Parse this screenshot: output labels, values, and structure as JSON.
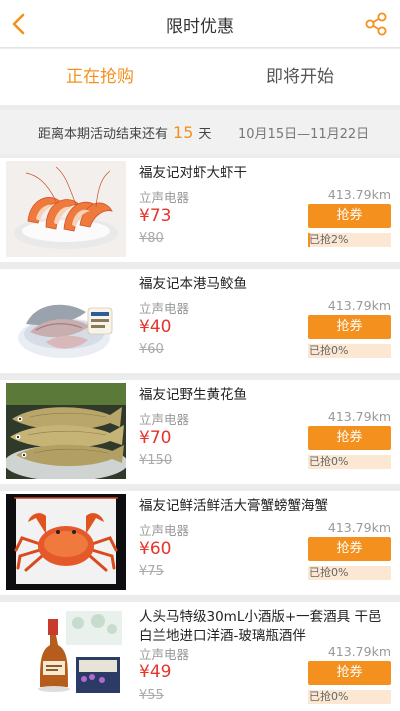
{
  "header": {
    "title": "限时优惠"
  },
  "tabs": [
    {
      "label": "正在抢购",
      "active": true
    },
    {
      "label": "即将开始",
      "active": false
    }
  ],
  "countdown": {
    "prefix": "距离本期活动结束还有",
    "days": "15",
    "suffix": "天",
    "range": "10月15日—11月22日"
  },
  "products": [
    {
      "name": "福友记对虾大虾干",
      "store": "立声电器",
      "distance": "413.79km",
      "price": "¥73",
      "original_price": "¥80",
      "button": "抢券",
      "progress_label": "已抢2%",
      "progress": 0.02,
      "image": "shrimp"
    },
    {
      "name": "福友记本港马鲛鱼",
      "store": "立声电器",
      "distance": "413.79km",
      "price": "¥40",
      "original_price": "¥60",
      "button": "抢券",
      "progress_label": "已抢0%",
      "progress": 0,
      "image": "mackerel"
    },
    {
      "name": "福友记野生黄花鱼",
      "store": "立声电器",
      "distance": "413.79km",
      "price": "¥70",
      "original_price": "¥150",
      "button": "抢券",
      "progress_label": "已抢0%",
      "progress": 0,
      "image": "croaker"
    },
    {
      "name": "福友记鲜活鲜活大膏蟹螃蟹海蟹",
      "store": "立声电器",
      "distance": "413.79km",
      "price": "¥60",
      "original_price": "¥75",
      "button": "抢券",
      "progress_label": "已抢0%",
      "progress": 0,
      "image": "crab"
    },
    {
      "name": "人头马特级30mL小酒版+一套酒具 干邑白兰地进口洋酒-玻璃瓶酒伴",
      "store": "立声电器",
      "distance": "413.79km",
      "price": "¥49",
      "original_price": "¥55",
      "button": "抢券",
      "progress_label": "已抢0%",
      "progress": 0,
      "image": "cognac"
    }
  ],
  "colors": {
    "accent": "#f4911e",
    "price": "#e5342b"
  }
}
